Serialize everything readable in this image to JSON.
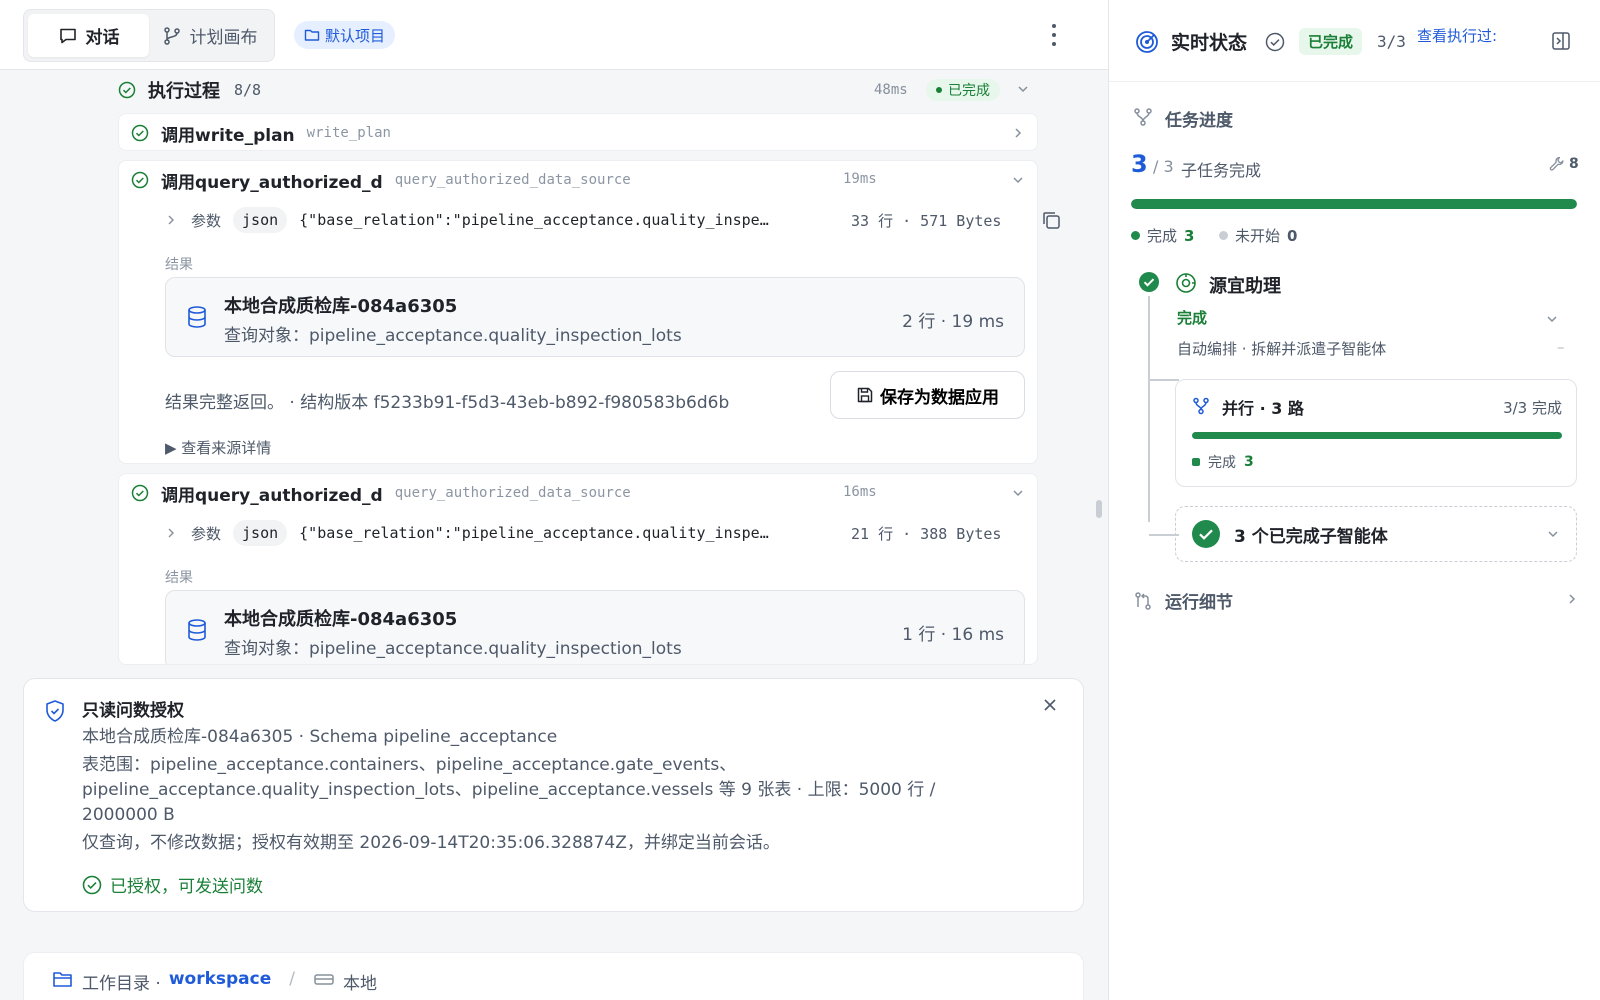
{
  "topbar": {
    "tabs": [
      {
        "label": "对话",
        "icon": "chat-bubble-icon"
      },
      {
        "label": "计划画布",
        "icon": "branch-icon"
      }
    ],
    "project": "默认项目"
  },
  "execution": {
    "title": "执行过程",
    "count": "8/8",
    "duration": "48ms",
    "status": "已完成"
  },
  "steps": [
    {
      "title": "调用write_plan",
      "tool": "write_plan"
    },
    {
      "title": "调用query_authorized_d",
      "tool": "query_authorized_data_source",
      "duration": "19ms",
      "param_label": "参数",
      "param_type": "json",
      "param_text": "{\"base_relation\":\"pipeline_acceptance.quality_inspe…",
      "param_meta": "33 行 · 571 Bytes",
      "result_label": "结果",
      "result_title": "本地合成质检库-084a6305",
      "result_sub": "查询对象：pipeline_acceptance.quality_inspection_lots",
      "result_meta": "2 行 · 19 ms",
      "full_text": "结果完整返回。 · 结构版本 f5233b91-f5d3-43eb-b892-f980583b6d6b",
      "save_label": "保存为数据应用",
      "source_link": "▶ 查看来源详情"
    },
    {
      "title": "调用query_authorized_d",
      "tool": "query_authorized_data_source",
      "duration": "16ms",
      "param_label": "参数",
      "param_type": "json",
      "param_text": "{\"base_relation\":\"pipeline_acceptance.quality_inspe…",
      "param_meta": "21 行 · 388 Bytes",
      "result_label": "结果",
      "result_title": "本地合成质检库-084a6305",
      "result_sub": "查询对象：pipeline_acceptance.quality_inspection_lots",
      "result_meta": "1 行 · 16 ms"
    }
  ],
  "auth": {
    "title": "只读问数授权",
    "line1": "本地合成质检库-084a6305 · Schema pipeline_acceptance",
    "line2": "表范围：pipeline_acceptance.containers、pipeline_acceptance.gate_events、pipeline_acceptance.quality_inspection_lots、pipeline_acceptance.vessels 等 9 张表 · 上限：5000 行 / 2000000 B",
    "line3": "仅查询，不修改数据；授权有效期至 2026-09-14T20:35:06.328874Z，并绑定当前会话。",
    "status": "已授权，可发送问数"
  },
  "bottombar": {
    "dir_label": "工作目录 ·",
    "workspace": "workspace",
    "sep": "/",
    "local": "本地"
  },
  "realtime": {
    "title": "实时状态",
    "status": "已完成",
    "count": "3/3",
    "link": "查看执行过:"
  },
  "progress": {
    "label": "任务进度",
    "done": "3",
    "of": "/ 3",
    "desc": "子任务完成",
    "tools": "8",
    "fraction": 1.0,
    "legend_done_label": "完成",
    "legend_done": "3",
    "legend_pending_label": "未开始",
    "legend_pending": "0"
  },
  "agent": {
    "name": "源宜助理",
    "status": "完成",
    "desc": "自动编排 · 拆解并派遣子智能体",
    "dash": "–",
    "parallel": {
      "title": "并行 · 3 路",
      "count": "3/3 完成",
      "fraction": 1.0,
      "legend_label": "完成",
      "legend_value": "3"
    },
    "subagents": "3 个已完成子智能体"
  },
  "run_detail": "运行细节",
  "colors": {
    "accent": "#1f5bd8",
    "success": "#1a7f37",
    "progress": "#1f8a4c"
  }
}
